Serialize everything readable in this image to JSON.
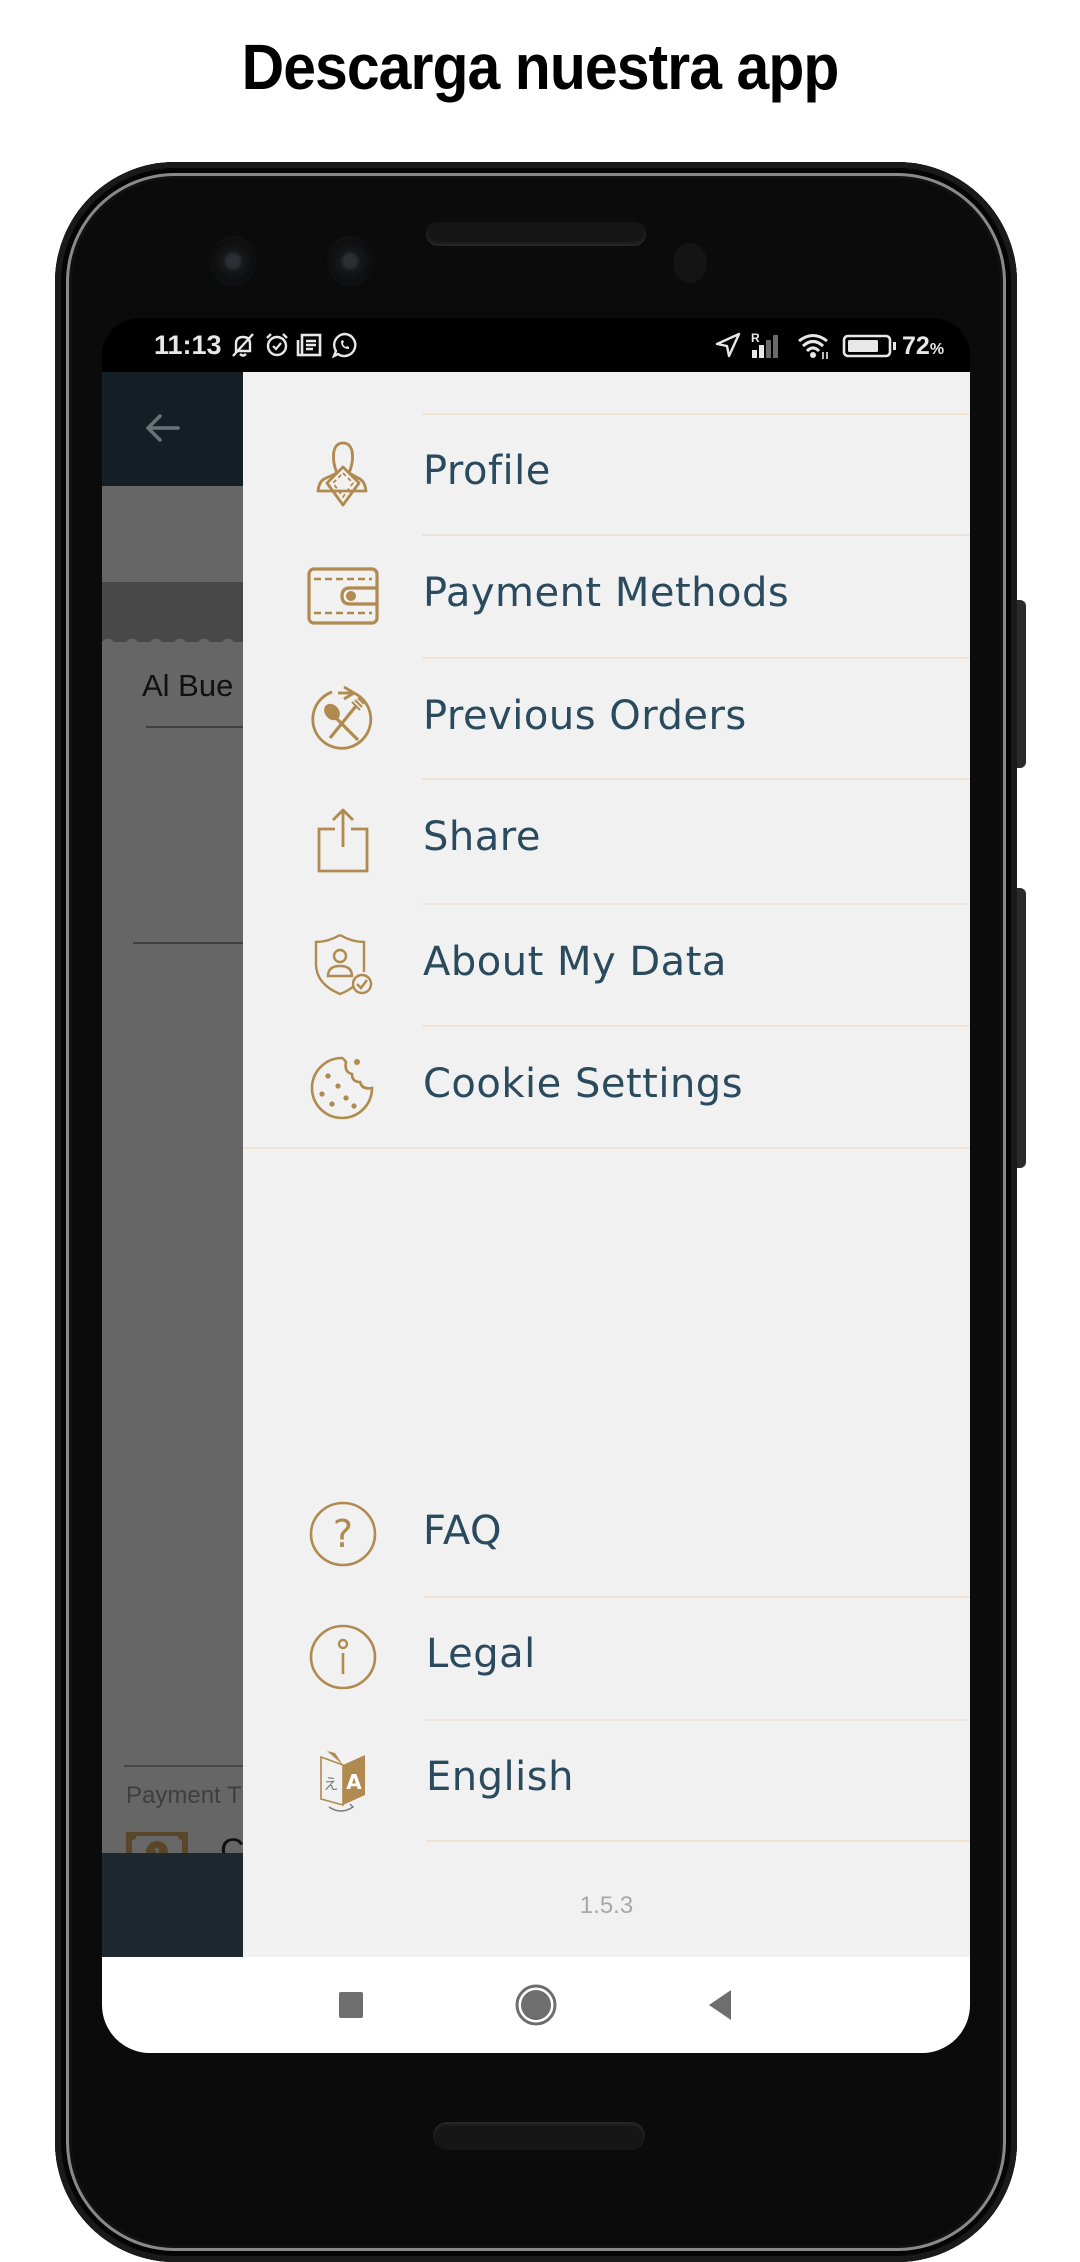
{
  "promo": {
    "title": "Descarga nuestra app"
  },
  "status_bar": {
    "time": "11:13",
    "left_icons": [
      "bell-off-icon",
      "alarm-icon",
      "news-icon",
      "whatsapp-icon"
    ],
    "right_icons": [
      "location-icon",
      "signal-roaming-icon",
      "wifi-icon",
      "battery-icon"
    ],
    "roaming_label": "R",
    "battery_percent": "72",
    "battery_suffix": "%"
  },
  "background_app": {
    "back_icon": "arrow-left-icon",
    "store_name_partial": "Al Bue",
    "payment_label_partial": "Payment T",
    "payment_method_partial": "C",
    "cash_icon_label": "1"
  },
  "drawer": {
    "menu_top": [
      {
        "id": "profile",
        "label": "Profile",
        "icon": "profile-napkin-icon"
      },
      {
        "id": "payment-methods",
        "label": "Payment Methods",
        "icon": "wallet-icon"
      },
      {
        "id": "previous-orders",
        "label": "Previous Orders",
        "icon": "previous-orders-icon"
      },
      {
        "id": "share",
        "label": "Share",
        "icon": "share-icon"
      },
      {
        "id": "about-my-data",
        "label": "About My Data",
        "icon": "data-privacy-shield-icon"
      },
      {
        "id": "cookie-settings",
        "label": "Cookie Settings",
        "icon": "cookie-icon"
      }
    ],
    "menu_bottom": [
      {
        "id": "faq",
        "label": "FAQ",
        "icon": "question-circle-icon"
      },
      {
        "id": "legal",
        "label": "Legal",
        "icon": "info-circle-icon"
      },
      {
        "id": "language",
        "label": "English",
        "icon": "translate-icon"
      }
    ],
    "version": "1.5.3"
  },
  "nav_bar": {
    "recents": "recents-square-icon",
    "home": "home-circle-icon",
    "back": "back-triangle-icon"
  },
  "colors": {
    "accent_gold": "#b08a4e",
    "label_text": "#2a4a5e",
    "drawer_bg": "#f1f1f1",
    "separator": "#efe3d3",
    "app_header": "#141e25"
  }
}
